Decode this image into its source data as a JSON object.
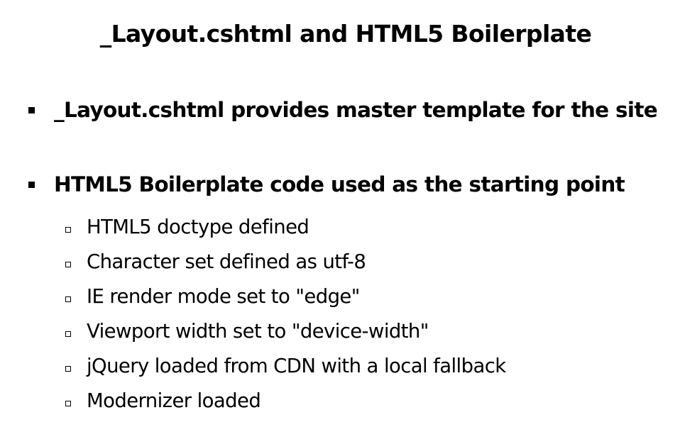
{
  "slide": {
    "title": "_Layout.cshtml and HTML5 Boilerplate",
    "bullets": [
      {
        "text": "_Layout.cshtml provides master template for the site",
        "subitems": []
      },
      {
        "text": "HTML5 Boilerplate code used as the starting point",
        "subitems": [
          "HTML5 doctype defined",
          "Character set defined as utf-8",
          "IE render mode set to \"edge\"",
          "Viewport width set to \"device-width\"",
          "jQuery loaded from CDN with a local fallback",
          "Modernizer loaded"
        ]
      }
    ]
  }
}
